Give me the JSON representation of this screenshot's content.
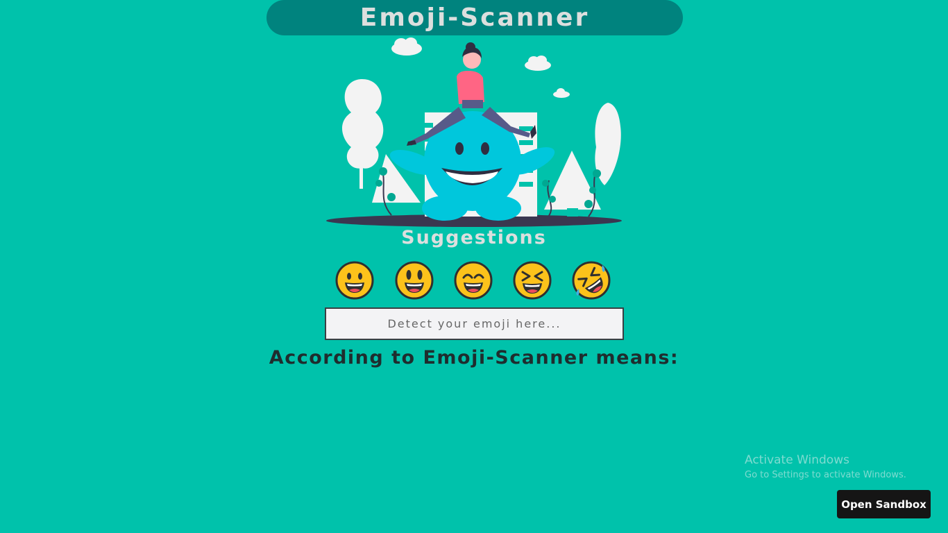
{
  "header": {
    "title": "Emoji-Scanner"
  },
  "suggestions": {
    "title": "Suggestions",
    "emojis": [
      "😀",
      "😃",
      "😄",
      "😆",
      "🤣"
    ]
  },
  "search": {
    "placeholder": "Detect your emoji here...",
    "value": ""
  },
  "result": {
    "heading": "According to Emoji-Scanner means:"
  },
  "watermark": {
    "title": "Activate Windows",
    "subtitle": "Go to Settings to activate Windows."
  },
  "sandbox": {
    "label": "Open Sandbox"
  },
  "colors": {
    "background": "#00c2ab",
    "header_bg": "#00837e",
    "title_text": "#dcdfde",
    "heading_text": "#1f2d2e",
    "button_bg": "#151515"
  }
}
